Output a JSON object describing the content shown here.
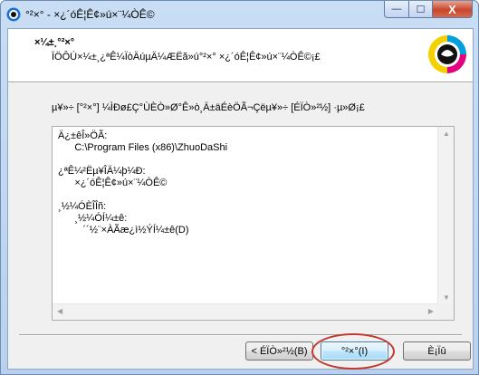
{
  "window": {
    "title": "°²×° - ×¿´óÊ¦Ê¢»ú×¨¼ÒÊ©",
    "minimize_glyph": "—",
    "maximize_glyph": "☐",
    "close_glyph": "X"
  },
  "header": {
    "title": "×¼±¸°²×°",
    "subtitle": "ÏÖÔÚ×¼±¸¿ªÊ¼ÏòÄúµÄ¼ÆËã»ú°²×° ×¿´óÊ¦Ê¢»ú×¨¼ÒÊ©¡£"
  },
  "body": {
    "description": "µ¥»÷ [°²×°] ¼ÌÐø£Ç°ÙÈÒ»Ø°Ê»ò¸Ä±äÉèÖÃ¬Çëµ¥»÷ [ÉÏÒ»²½] ·µ»Ø¡£",
    "info_lines": [
      "Ä¿±êÎ»ÖÃ:",
      "      C:\\Program Files (x86)\\ZhuoDaShi",
      "",
      "¿ªÊ¼²Ëµ¥ÎÄ¼þ¼Ð:",
      "      ×¿´óÊ¦Ê¢»ú×¨¼ÒÊ©",
      "",
      "¸½¼ÓÈÎÎñ:",
      "      ¸½¼ÓÍ¼±ê:",
      "         ´´½¨×ÀÃæ¿ì½ÝÍ¼±ê(D)"
    ]
  },
  "footer": {
    "brand": "",
    "back_label": "< ÉÏÒ»²½(B)",
    "install_label": "°²×°(I)",
    "cancel_label": "È¡Ïû"
  },
  "colors": {
    "highlight_circle": "#c0392b",
    "close_button": "#c7462b"
  }
}
